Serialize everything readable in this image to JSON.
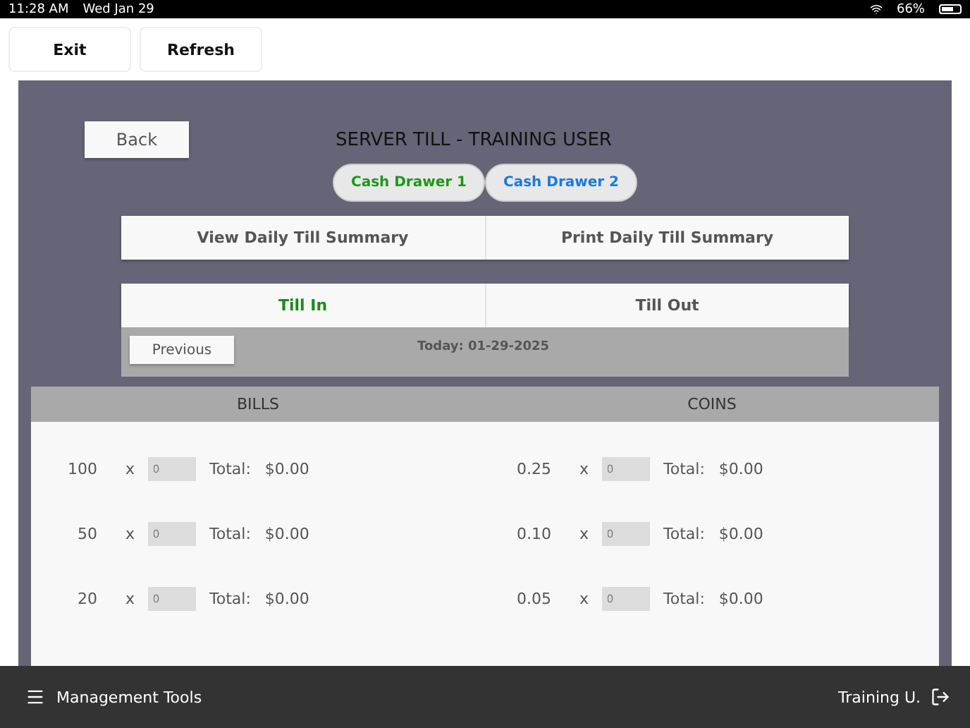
{
  "status_bar": {
    "time": "11:28 AM",
    "date": "Wed Jan 29",
    "battery": "66%"
  },
  "toolbar": {
    "buttons": [
      "Exit",
      "Refresh"
    ]
  },
  "header": {
    "back": "Back",
    "title": "SERVER TILL - TRAINING USER"
  },
  "drawers": [
    {
      "label": "Cash Drawer 1",
      "selected": true
    },
    {
      "label": "Cash Drawer 2",
      "selected": false
    }
  ],
  "summary_buttons": [
    "View Daily Till Summary",
    "Print Daily Till Summary"
  ],
  "till_tabs": [
    {
      "label": "Till In",
      "selected": true
    },
    {
      "label": "Till Out",
      "selected": false
    }
  ],
  "date_bar": {
    "previous": "Previous",
    "today": "Today: 01-29-2025"
  },
  "counts": {
    "columns": [
      "BILLS",
      "COINS"
    ],
    "rows": [
      [
        {
          "denomination": "100",
          "x": "x",
          "placeholder": "0",
          "total_label": "Total:",
          "total": "$0.00"
        },
        {
          "denomination": "0.25",
          "x": "x",
          "placeholder": "0",
          "total_label": "Total:",
          "total": "$0.00"
        }
      ],
      [
        {
          "denomination": "50",
          "x": "x",
          "placeholder": "0",
          "total_label": "Total:",
          "total": "$0.00"
        },
        {
          "denomination": "0.10",
          "x": "x",
          "placeholder": "0",
          "total_label": "Total:",
          "total": "$0.00"
        }
      ],
      [
        {
          "denomination": "20",
          "x": "x",
          "placeholder": "0",
          "total_label": "Total:",
          "total": "$0.00"
        },
        {
          "denomination": "0.05",
          "x": "x",
          "placeholder": "0",
          "total_label": "Total:",
          "total": "$0.00"
        }
      ]
    ]
  },
  "bottom_bar": {
    "menu": "Management Tools",
    "user": "Training U."
  }
}
